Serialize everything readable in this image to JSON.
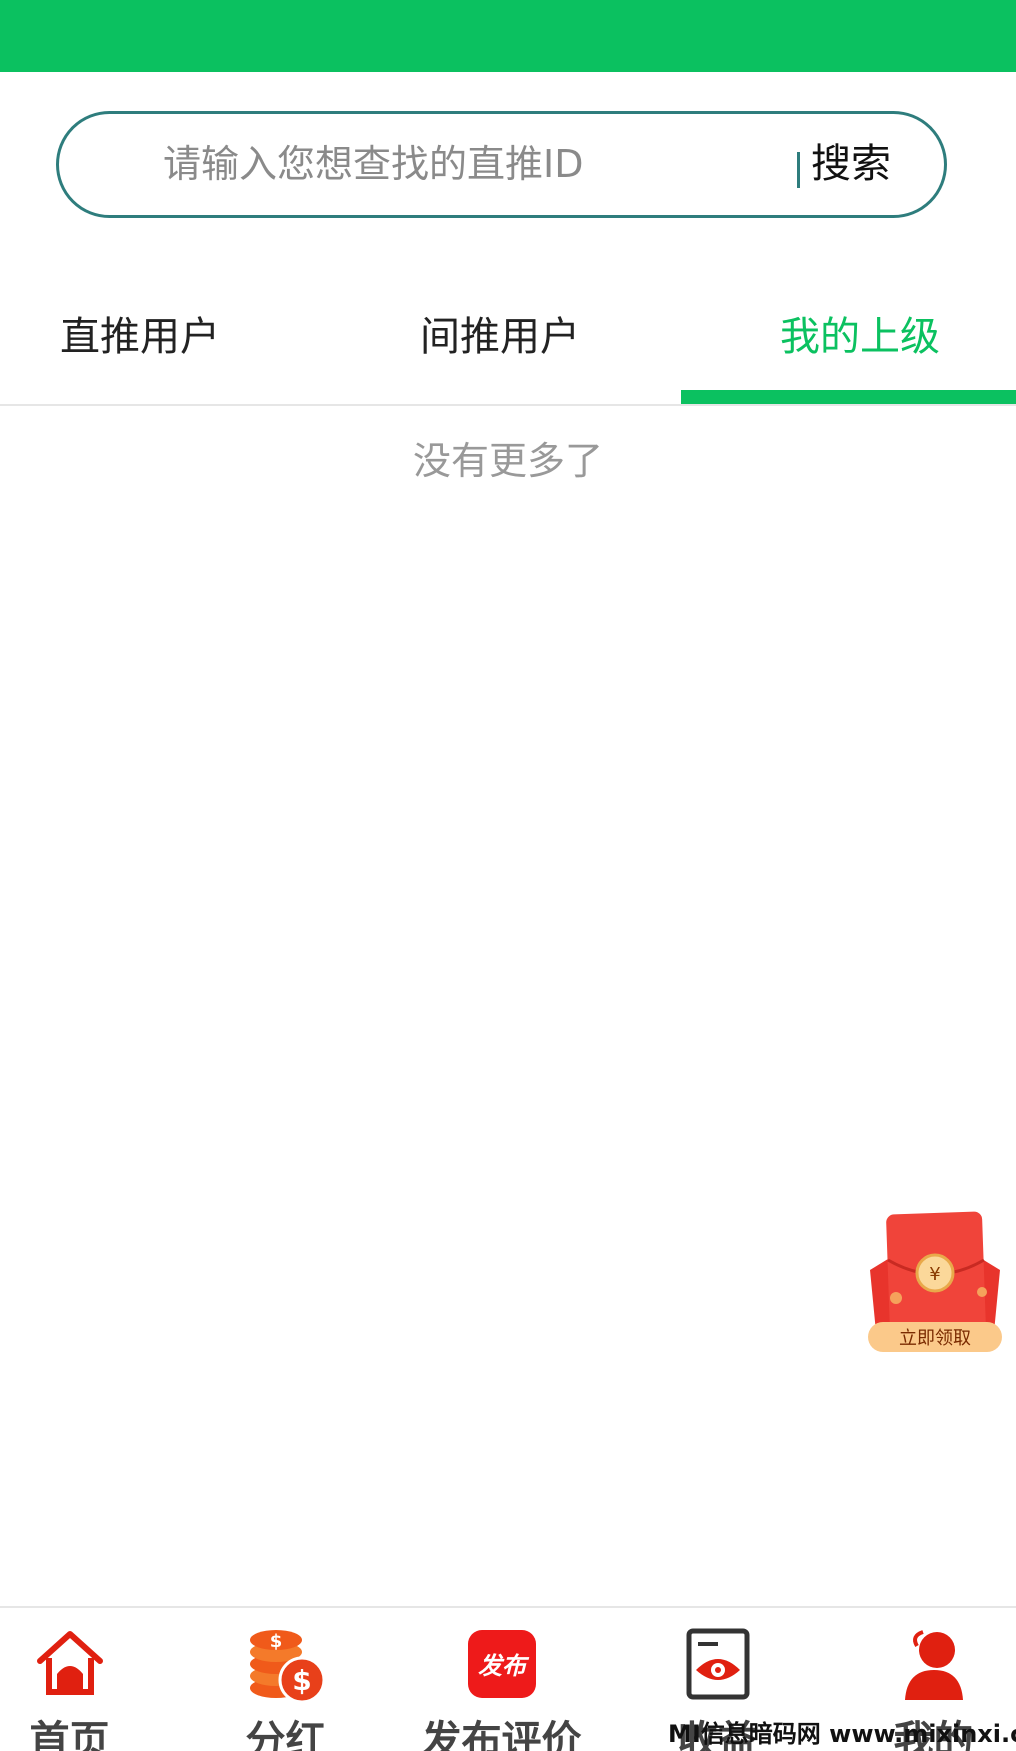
{
  "search": {
    "placeholder": "请输入您想查找的直推ID",
    "button_label": "搜索"
  },
  "tabs": [
    {
      "label": "直推用户",
      "active": false
    },
    {
      "label": "间推用户",
      "active": false
    },
    {
      "label": "我的上级",
      "active": true
    }
  ],
  "list": {
    "empty_text": "没有更多了"
  },
  "promo": {
    "coin_symbol": "¥",
    "label": "立即领取"
  },
  "bottom_nav": [
    {
      "label": "首页",
      "icon": "home-icon"
    },
    {
      "label": "分红",
      "icon": "dollar-coins-icon"
    },
    {
      "label": "发布评价",
      "icon": "publish-icon",
      "icon_text": "发布"
    },
    {
      "label": "收益",
      "icon": "eye-document-icon"
    },
    {
      "label": "我的",
      "icon": "user-icon"
    }
  ],
  "watermark": "MI信息暗码网 www.mixinxi.com",
  "colors": {
    "accent": "#0bc160",
    "search_border": "#2e7d7d",
    "nav_red": "#e02010",
    "nav_orange": "#f05a1a"
  }
}
